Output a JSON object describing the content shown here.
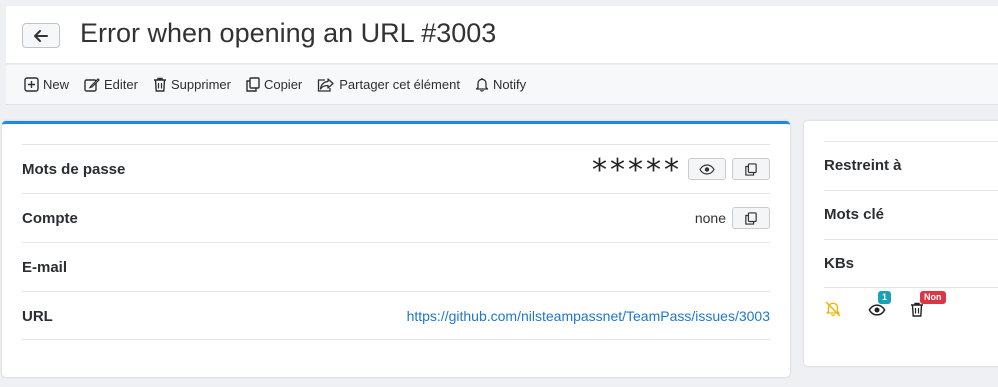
{
  "header": {
    "title": "Error when opening an URL #3003"
  },
  "toolbar": {
    "items": [
      {
        "label": "New",
        "icon": "plus-square-icon"
      },
      {
        "label": "Editer",
        "icon": "edit-icon"
      },
      {
        "label": "Supprimer",
        "icon": "trash-icon"
      },
      {
        "label": "Copier",
        "icon": "copy-icon"
      },
      {
        "label": "Partager cet élément",
        "icon": "share-icon"
      },
      {
        "label": "Notify",
        "icon": "bell-icon"
      }
    ]
  },
  "fields": {
    "password": {
      "label": "Mots de passe",
      "value": "*****"
    },
    "account": {
      "label": "Compte",
      "value": "none"
    },
    "email": {
      "label": "E-mail"
    },
    "url": {
      "label": "URL",
      "value": "https://github.com/nilsteampassnet/TeamPass/issues/3003"
    }
  },
  "side": {
    "restricted_label": "Restreint à",
    "keywords_label": "Mots clé",
    "kbs_label": "KBs",
    "views_badge": "1",
    "delete_badge": "Non"
  },
  "colors": {
    "accent": "#1e88e5",
    "link": "#1f78c8",
    "badge_info": "#17a2b8",
    "badge_danger": "#dc3545",
    "warning": "#f0b400"
  }
}
